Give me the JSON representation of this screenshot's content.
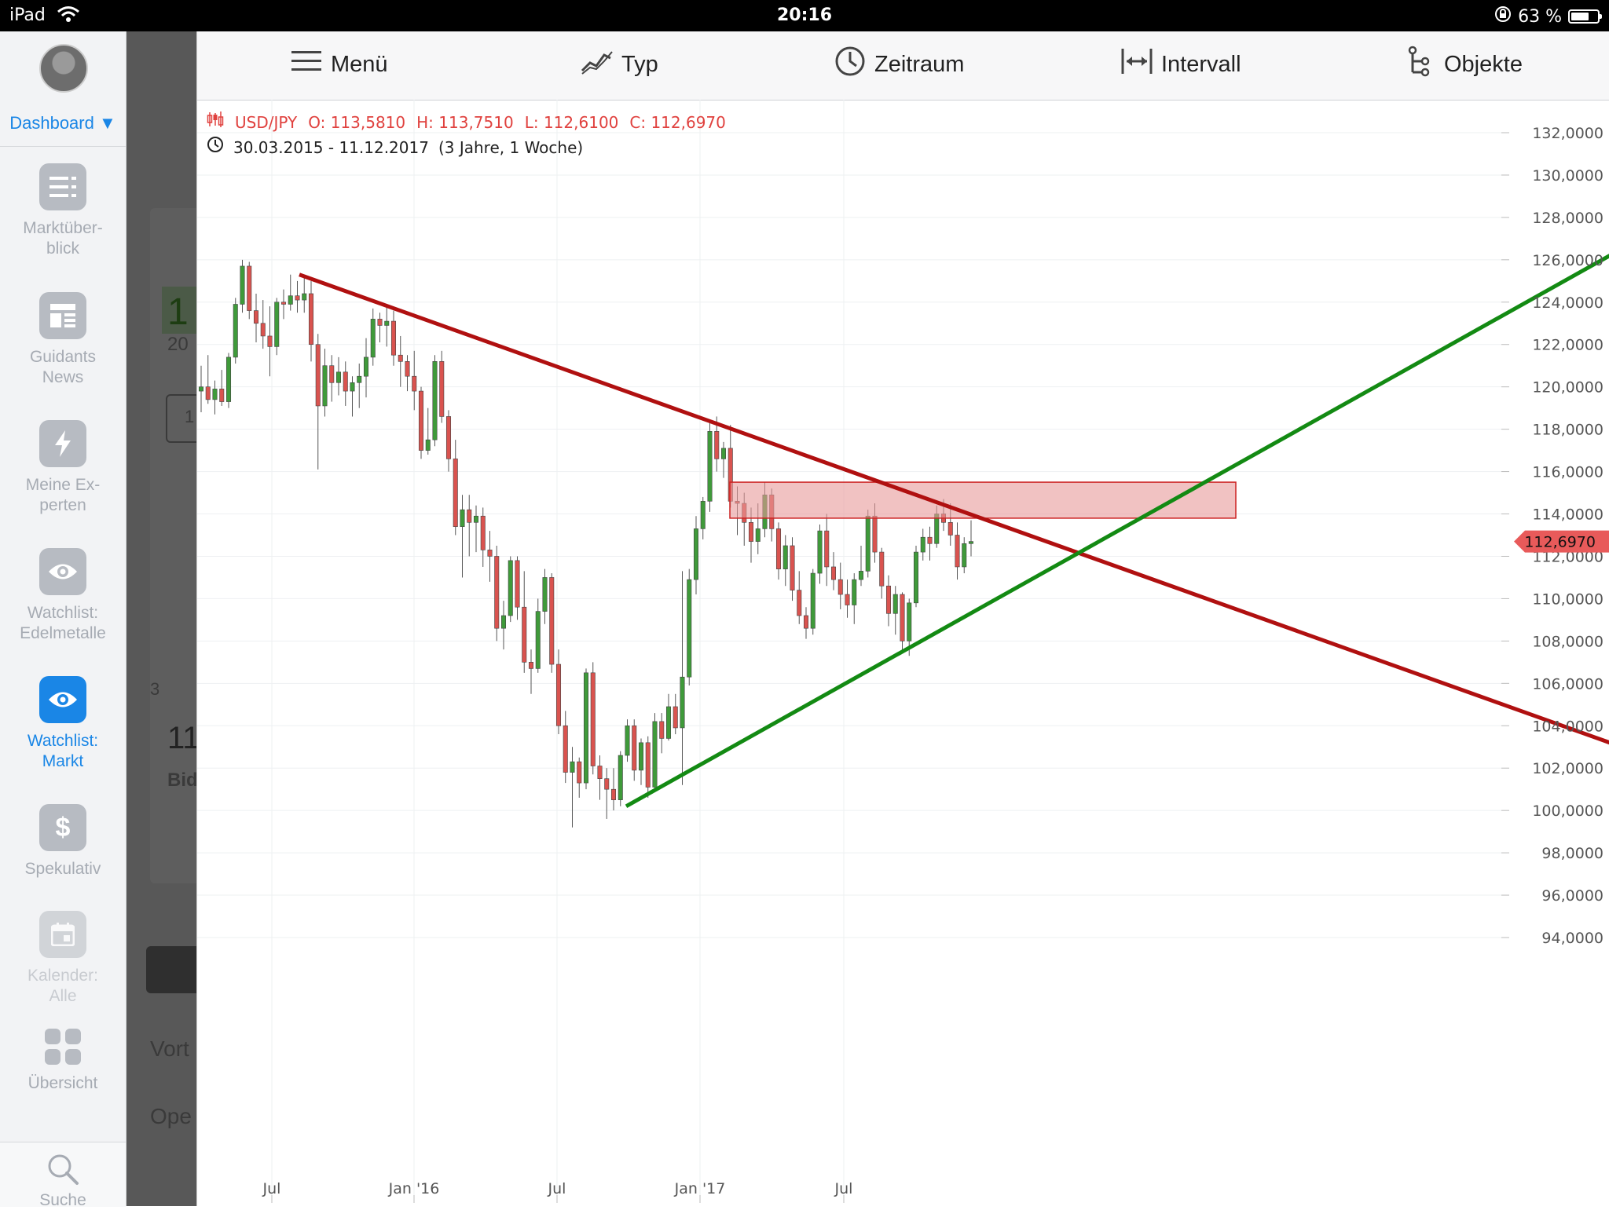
{
  "status_bar": {
    "device": "iPad",
    "time": "20:16",
    "battery": "63 %"
  },
  "sidebar": {
    "dashboard_label": "Dashboard",
    "items": [
      {
        "label": "Marktüber-\nblick",
        "icon": "list-icon"
      },
      {
        "label": "Guidants\nNews",
        "icon": "news-icon"
      },
      {
        "label": "Meine Ex-\nperten",
        "icon": "lightning-icon"
      },
      {
        "label": "Watchlist:\nEdelmetalle",
        "icon": "eye-icon"
      },
      {
        "label": "Watchlist:\nMarkt",
        "icon": "eye-icon",
        "active": true
      },
      {
        "label": "Spekulativ",
        "icon": "dollar-icon"
      },
      {
        "label": "Kalender:\nAlle",
        "icon": "calendar-icon"
      }
    ],
    "overview_label": "Übersicht",
    "search_label": "Suche"
  },
  "background_panel": {
    "fragments": [
      "1",
      "20",
      "1",
      "3",
      "11",
      "Bid",
      "Vort",
      "Ope"
    ]
  },
  "toolbar": {
    "menu": "Menü",
    "type": "Typ",
    "period": "Zeitraum",
    "interval": "Intervall",
    "objects": "Objekte"
  },
  "chart_info": {
    "symbol": "USD/JPY",
    "open": "O: 113,5810",
    "high": "H: 113,7510",
    "low": "L: 112,6100",
    "close": "C: 112,6970",
    "range": "30.03.2015 - 11.12.2017",
    "duration": "(3 Jahre, 1 Woche)"
  },
  "chart_data": {
    "type": "candlestick",
    "title": "USD/JPY",
    "y_axis_ticks": [
      "132,0000",
      "130,0000",
      "128,0000",
      "126,0000",
      "124,0000",
      "122,0000",
      "120,0000",
      "118,0000",
      "116,0000",
      "114,0000",
      "112,0000",
      "110,0000",
      "108,0000",
      "106,0000",
      "104,0000",
      "102,0000",
      "100,0000",
      "98,0000",
      "96,0000",
      "94,0000"
    ],
    "ylim": [
      93.0,
      133.0
    ],
    "x_axis_ticks": [
      "Jul",
      "Jan '16",
      "Jul",
      "Jan '17",
      "Jul"
    ],
    "last_price_label": "112,6970",
    "last_price": 112.697,
    "colors": {
      "up": "#3f9a3a",
      "down": "#d9534f",
      "resistance": "#b01010",
      "support": "#138a13",
      "zone": "#e89a9a"
    },
    "candles_approx_weekly_ohlc": [
      [
        119.8,
        121.0,
        118.8,
        120.0
      ],
      [
        120.0,
        121.5,
        119.2,
        119.4
      ],
      [
        119.4,
        120.3,
        118.7,
        119.9
      ],
      [
        119.9,
        120.8,
        119.1,
        119.3
      ],
      [
        119.3,
        121.6,
        119.0,
        121.4
      ],
      [
        121.4,
        124.2,
        121.1,
        123.9
      ],
      [
        123.9,
        126.0,
        123.5,
        125.7
      ],
      [
        125.7,
        125.9,
        123.2,
        123.6
      ],
      [
        123.6,
        124.4,
        122.1,
        123.0
      ],
      [
        123.0,
        124.1,
        121.8,
        122.4
      ],
      [
        122.4,
        123.8,
        120.5,
        121.9
      ],
      [
        121.9,
        124.2,
        121.5,
        124.0
      ],
      [
        124.0,
        124.6,
        123.2,
        123.9
      ],
      [
        123.9,
        125.3,
        123.6,
        124.3
      ],
      [
        124.3,
        125.0,
        123.5,
        124.1
      ],
      [
        124.1,
        125.2,
        123.5,
        124.4
      ],
      [
        124.4,
        125.0,
        121.2,
        122.0
      ],
      [
        122.0,
        122.5,
        116.1,
        119.1
      ],
      [
        119.1,
        121.8,
        118.6,
        121.0
      ],
      [
        121.0,
        121.5,
        119.3,
        120.2
      ],
      [
        120.2,
        121.4,
        119.6,
        120.7
      ],
      [
        120.7,
        121.2,
        119.1,
        119.8
      ],
      [
        119.8,
        120.5,
        118.6,
        120.2
      ],
      [
        120.2,
        121.1,
        119.0,
        120.5
      ],
      [
        120.5,
        122.3,
        119.5,
        121.4
      ],
      [
        121.4,
        123.7,
        121.0,
        123.2
      ],
      [
        123.2,
        123.5,
        122.1,
        122.9
      ],
      [
        122.9,
        123.8,
        121.9,
        123.1
      ],
      [
        123.1,
        123.6,
        121.0,
        121.5
      ],
      [
        121.5,
        122.4,
        120.0,
        121.2
      ],
      [
        121.2,
        121.5,
        119.8,
        120.5
      ],
      [
        120.5,
        121.7,
        118.9,
        119.8
      ],
      [
        119.8,
        120.0,
        116.6,
        117.0
      ],
      [
        117.0,
        119.0,
        116.8,
        117.5
      ],
      [
        117.5,
        121.5,
        117.2,
        121.2
      ],
      [
        121.2,
        121.7,
        118.3,
        118.6
      ],
      [
        118.6,
        118.9,
        116.0,
        116.6
      ],
      [
        116.6,
        117.5,
        113.0,
        113.4
      ],
      [
        113.4,
        114.9,
        111.0,
        114.2
      ],
      [
        114.2,
        114.9,
        112.0,
        113.6
      ],
      [
        113.6,
        114.4,
        112.2,
        113.9
      ],
      [
        113.9,
        114.3,
        111.5,
        112.3
      ],
      [
        112.3,
        113.2,
        110.8,
        112.0
      ],
      [
        112.0,
        112.5,
        108.0,
        108.6
      ],
      [
        108.6,
        109.9,
        107.6,
        109.2
      ],
      [
        109.2,
        112.0,
        108.9,
        111.8
      ],
      [
        111.8,
        112.0,
        109.0,
        109.6
      ],
      [
        109.6,
        111.3,
        106.5,
        107.0
      ],
      [
        107.0,
        107.6,
        105.5,
        106.7
      ],
      [
        106.7,
        110.0,
        106.5,
        109.4
      ],
      [
        109.4,
        111.4,
        108.8,
        111.0
      ],
      [
        111.0,
        111.2,
        106.5,
        106.9
      ],
      [
        106.9,
        107.6,
        103.6,
        104.0
      ],
      [
        104.0,
        104.7,
        101.3,
        101.8
      ],
      [
        101.8,
        103.0,
        99.2,
        102.3
      ],
      [
        102.3,
        102.5,
        100.6,
        101.3
      ],
      [
        101.3,
        106.7,
        101.0,
        106.5
      ],
      [
        106.5,
        107.0,
        101.7,
        102.1
      ],
      [
        102.1,
        102.6,
        100.5,
        101.5
      ],
      [
        101.5,
        102.0,
        99.6,
        101.0
      ],
      [
        101.0,
        102.0,
        100.0,
        100.5
      ],
      [
        100.5,
        102.8,
        100.2,
        102.6
      ],
      [
        102.6,
        104.3,
        102.3,
        104.0
      ],
      [
        104.0,
        104.3,
        101.4,
        101.9
      ],
      [
        101.9,
        103.4,
        101.2,
        103.2
      ],
      [
        103.2,
        103.5,
        100.6,
        101.1
      ],
      [
        101.1,
        104.6,
        101.0,
        104.2
      ],
      [
        104.2,
        104.6,
        102.7,
        103.4
      ],
      [
        103.4,
        105.5,
        103.3,
        104.9
      ],
      [
        104.9,
        105.5,
        103.6,
        103.9
      ],
      [
        103.9,
        111.3,
        101.2,
        106.3
      ],
      [
        106.3,
        111.4,
        105.9,
        110.9
      ],
      [
        110.9,
        113.9,
        110.2,
        113.3
      ],
      [
        113.3,
        114.8,
        112.8,
        114.6
      ],
      [
        114.6,
        118.4,
        114.1,
        117.9
      ],
      [
        117.9,
        118.6,
        116.0,
        116.6
      ],
      [
        116.6,
        117.4,
        115.7,
        117.1
      ],
      [
        117.1,
        118.2,
        114.3,
        114.6
      ],
      [
        114.6,
        115.3,
        113.0,
        114.5
      ],
      [
        114.5,
        115.0,
        112.5,
        113.6
      ],
      [
        113.6,
        114.3,
        111.7,
        112.7
      ],
      [
        112.7,
        114.5,
        112.1,
        113.3
      ],
      [
        113.3,
        115.5,
        112.9,
        114.9
      ],
      [
        114.9,
        115.2,
        112.7,
        113.3
      ],
      [
        113.3,
        113.6,
        110.9,
        111.4
      ],
      [
        111.4,
        113.0,
        110.6,
        112.5
      ],
      [
        112.5,
        112.9,
        109.9,
        110.4
      ],
      [
        110.4,
        111.3,
        108.8,
        109.2
      ],
      [
        109.2,
        109.6,
        108.1,
        108.6
      ],
      [
        108.6,
        111.4,
        108.3,
        111.2
      ],
      [
        111.2,
        113.5,
        110.7,
        113.2
      ],
      [
        113.2,
        114.0,
        110.6,
        111.5
      ],
      [
        111.5,
        112.2,
        110.4,
        110.9
      ],
      [
        110.9,
        111.7,
        109.5,
        110.2
      ],
      [
        110.2,
        110.9,
        109.1,
        109.7
      ],
      [
        109.7,
        111.2,
        108.8,
        110.9
      ],
      [
        110.9,
        112.5,
        110.6,
        111.3
      ],
      [
        111.3,
        114.2,
        111.0,
        113.9
      ],
      [
        113.9,
        114.5,
        111.7,
        112.2
      ],
      [
        112.2,
        112.4,
        110.0,
        110.6
      ],
      [
        110.6,
        111.1,
        108.7,
        109.3
      ],
      [
        109.3,
        110.6,
        108.3,
        110.2
      ],
      [
        110.2,
        110.3,
        107.5,
        108.0
      ],
      [
        108.0,
        110.0,
        107.3,
        109.8
      ],
      [
        109.8,
        112.5,
        109.6,
        112.2
      ],
      [
        112.2,
        113.3,
        111.8,
        112.9
      ],
      [
        112.9,
        113.4,
        111.8,
        112.6
      ],
      [
        112.6,
        114.4,
        112.4,
        114.0
      ],
      [
        114.0,
        114.7,
        113.2,
        113.6
      ],
      [
        113.6,
        114.5,
        112.5,
        113.0
      ],
      [
        113.0,
        113.6,
        110.9,
        111.5
      ],
      [
        111.5,
        112.9,
        111.2,
        112.6
      ],
      [
        112.6,
        113.7,
        112.0,
        112.7
      ]
    ],
    "annotations": [
      {
        "type": "trendline",
        "name": "resistance",
        "color": "#b01010",
        "from": [
          "2015-07",
          125.3
        ],
        "to": [
          "2018-03",
          103.2
        ]
      },
      {
        "type": "trendline",
        "name": "support",
        "color": "#138a13",
        "from": [
          "2016-09",
          100.2
        ],
        "to": [
          "2018-03",
          126.2
        ]
      },
      {
        "type": "rectangle",
        "name": "resistance-zone",
        "price_range": [
          113.8,
          115.5
        ]
      }
    ]
  }
}
